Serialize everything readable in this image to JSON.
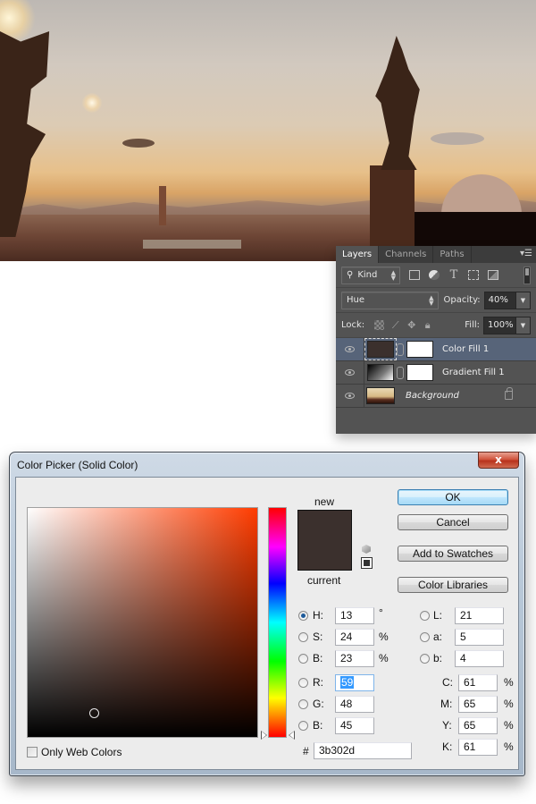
{
  "layers_panel": {
    "tabs": [
      {
        "label": "Layers",
        "active": true
      },
      {
        "label": "Channels",
        "active": false
      },
      {
        "label": "Paths",
        "active": false
      }
    ],
    "menu_icon": "panel-menu-icon",
    "filter": {
      "kind_label": "Kind",
      "icons": [
        "pixel-filter-icon",
        "adjustment-filter-icon",
        "type-filter-icon",
        "shape-filter-icon",
        "smart-object-filter-icon"
      ]
    },
    "blend_mode": "Hue",
    "opacity_label": "Opacity:",
    "opacity_value": "40%",
    "lock_label": "Lock:",
    "fill_label": "Fill:",
    "fill_value": "100%",
    "layers": [
      {
        "name": "Color Fill 1",
        "selected": true,
        "visible": true,
        "type": "color-fill"
      },
      {
        "name": "Gradient Fill 1",
        "selected": false,
        "visible": true,
        "type": "gradient-fill"
      },
      {
        "name": "Background",
        "selected": false,
        "visible": true,
        "type": "background",
        "locked": true
      }
    ]
  },
  "color_picker": {
    "title": "Color Picker (Solid Color)",
    "close_label": "x",
    "new_label": "new",
    "current_label": "current",
    "new_color": "#3b302d",
    "current_color": "#3b302d",
    "buttons": {
      "ok": "OK",
      "cancel": "Cancel",
      "add_to_swatches": "Add to Swatches",
      "color_libraries": "Color Libraries"
    },
    "hsb": {
      "h": {
        "label": "H:",
        "value": "13",
        "unit": "°",
        "selected": true
      },
      "s": {
        "label": "S:",
        "value": "24",
        "unit": "%"
      },
      "b": {
        "label": "B:",
        "value": "23",
        "unit": "%"
      }
    },
    "rgb": {
      "r": {
        "label": "R:",
        "value": "59"
      },
      "g": {
        "label": "G:",
        "value": "48"
      },
      "b": {
        "label": "B:",
        "value": "45"
      }
    },
    "lab": {
      "l": {
        "label": "L:",
        "value": "21"
      },
      "a": {
        "label": "a:",
        "value": "5"
      },
      "b": {
        "label": "b:",
        "value": "4"
      }
    },
    "cmyk": {
      "c": {
        "label": "C:",
        "value": "61",
        "unit": "%"
      },
      "m": {
        "label": "M:",
        "value": "65",
        "unit": "%"
      },
      "y": {
        "label": "Y:",
        "value": "65",
        "unit": "%"
      },
      "k": {
        "label": "K:",
        "value": "61",
        "unit": "%"
      }
    },
    "hex_label": "#",
    "hex_value": "3b302d",
    "only_web_colors_label": "Only Web Colors",
    "only_web_colors_checked": false,
    "hue_slider_hue_deg": 13,
    "saturation_percent": 24,
    "brightness_percent": 23
  }
}
